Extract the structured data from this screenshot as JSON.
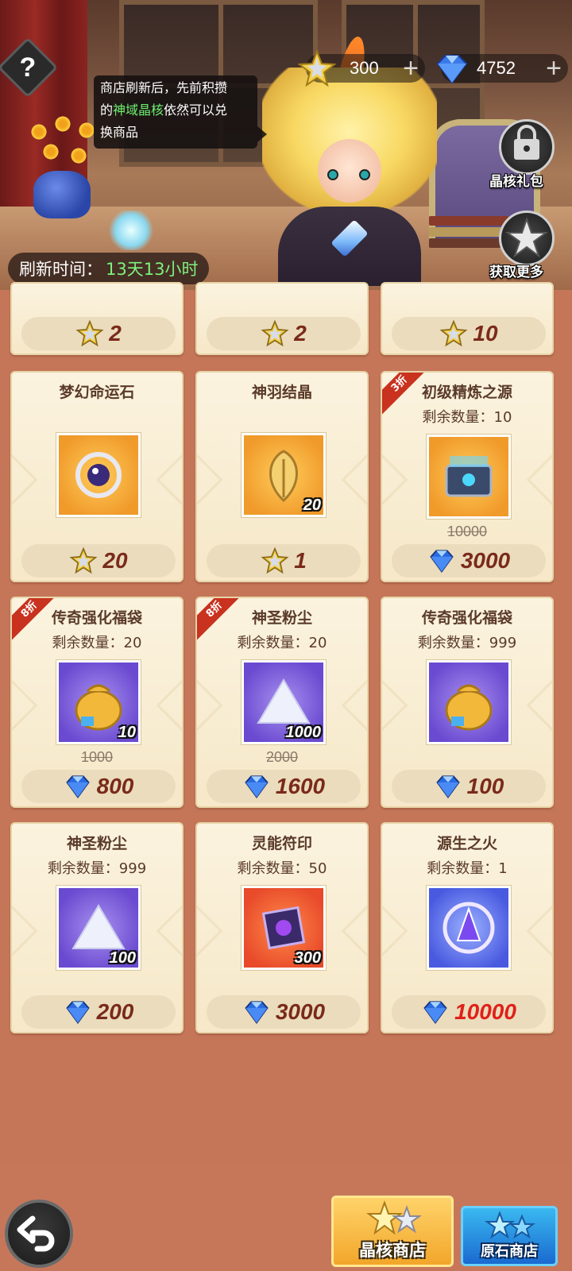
{
  "header": {
    "help_label": "?",
    "tooltip": {
      "line1": "商店刷新后，先前积攒",
      "line2_prefix": "的",
      "line2_highlight": "神域晶核",
      "line2_suffix": "依然可以兑",
      "line3": "换商品"
    },
    "currency_star": "300",
    "currency_gem": "4752",
    "plus": "+",
    "side_buttons": [
      "晶核礼包",
      "获取更多"
    ],
    "refresh_label": "刷新时间：",
    "refresh_value": "13天13小时"
  },
  "top_row_prices": [
    "2",
    "2",
    "10"
  ],
  "items": [
    {
      "name": "梦幻命运石",
      "stock": "",
      "qty": "",
      "old_price": "",
      "price": "20",
      "currency": "star",
      "discount": "",
      "art": "fate-stone",
      "color": "orange"
    },
    {
      "name": "神羽结晶",
      "stock": "",
      "qty": "20",
      "old_price": "",
      "price": "1",
      "currency": "star",
      "discount": "",
      "art": "feather-crystal",
      "color": "orange"
    },
    {
      "name": "初级精炼之源",
      "stock": "剩余数量：10",
      "qty": "",
      "old_price": "10000",
      "price": "3000",
      "currency": "gem",
      "discount": "3折",
      "art": "chest",
      "color": "orange"
    },
    {
      "name": "传奇强化福袋",
      "stock": "剩余数量：20",
      "qty": "10",
      "old_price": "1000",
      "price": "800",
      "currency": "gem",
      "discount": "8折",
      "art": "bag",
      "color": "purple"
    },
    {
      "name": "神圣粉尘",
      "stock": "剩余数量：20",
      "qty": "1000",
      "old_price": "2000",
      "price": "1600",
      "currency": "gem",
      "discount": "8折",
      "art": "dust",
      "color": "purple"
    },
    {
      "name": "传奇强化福袋",
      "stock": "剩余数量：999",
      "qty": "",
      "old_price": "",
      "price": "100",
      "currency": "gem",
      "discount": "",
      "art": "bag",
      "color": "purple"
    },
    {
      "name": "神圣粉尘",
      "stock": "剩余数量：999",
      "qty": "100",
      "old_price": "",
      "price": "200",
      "currency": "gem",
      "discount": "",
      "art": "dust",
      "color": "purple"
    },
    {
      "name": "灵能符印",
      "stock": "剩余数量：50",
      "qty": "300",
      "old_price": "",
      "price": "3000",
      "currency": "gem",
      "discount": "",
      "art": "sigil",
      "color": "red"
    },
    {
      "name": "源生之火",
      "stock": "剩余数量：1",
      "qty": "",
      "old_price": "",
      "price": "10000",
      "currency": "gem",
      "discount": "",
      "art": "fire",
      "color": "blue",
      "price_color": "red"
    }
  ],
  "tabs": {
    "core_shop": "晶核商店",
    "ore_shop": "原石商店"
  },
  "colors": {
    "background": "#c57659",
    "card": "#fbf3df",
    "price_text": "#7a2a1a",
    "highlight_green": "#7ef07e",
    "discount_red": "#c8321e"
  }
}
